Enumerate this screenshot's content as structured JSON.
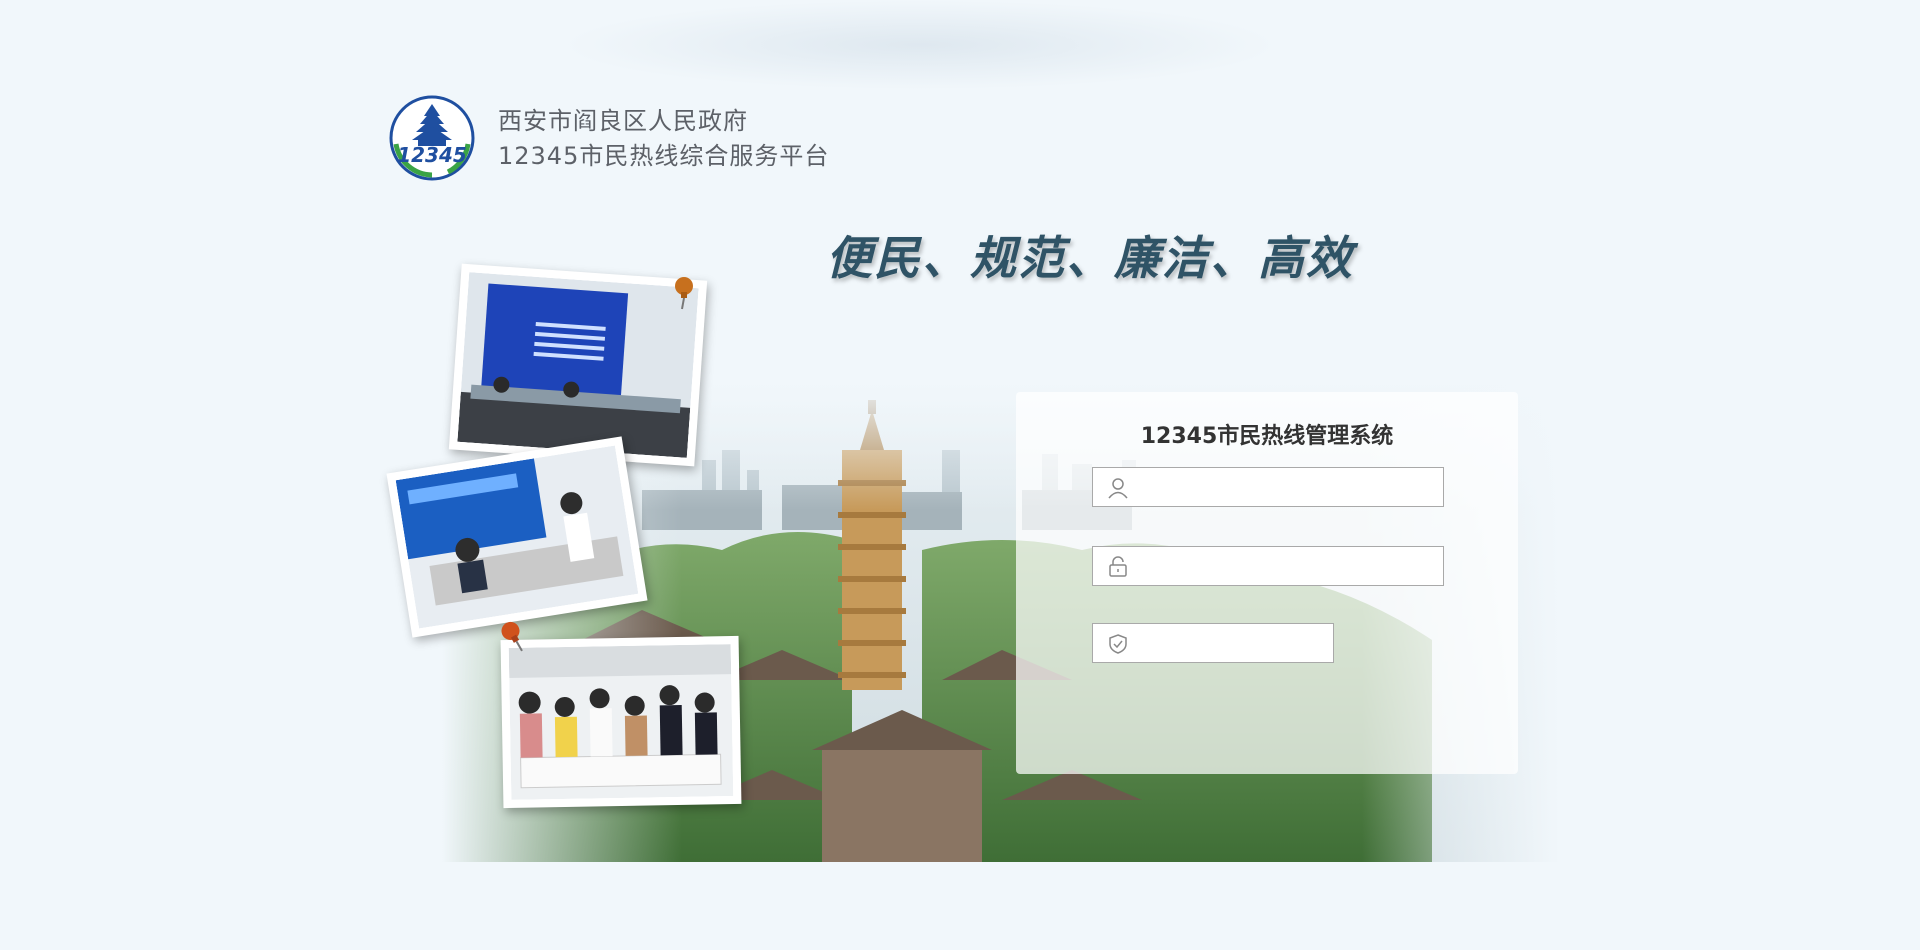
{
  "header": {
    "logo_icon": "hotline-12345-logo",
    "logo_text": "12345",
    "line1": "西安市阎良区人民政府",
    "line2": "12345市民热线综合服务平台"
  },
  "slogan": "便民、规范、廉洁、高效",
  "login": {
    "title": "12345市民热线管理系统",
    "username": {
      "icon": "user-icon",
      "value": "",
      "placeholder": ""
    },
    "password": {
      "icon": "lock-icon",
      "value": "",
      "placeholder": ""
    },
    "captcha": {
      "icon": "shield-check-icon",
      "value": "",
      "placeholder": ""
    }
  },
  "colors": {
    "background": "#f1f7fb",
    "slogan": "#2f5366",
    "logo_blue": "#1f4fa0",
    "logo_green": "#3aa345"
  }
}
